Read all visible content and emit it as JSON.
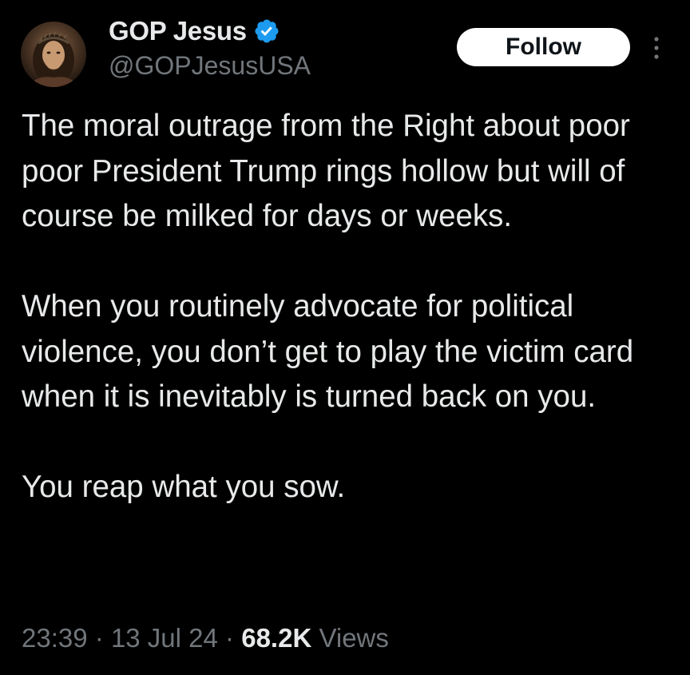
{
  "author": {
    "display_name": "GOP Jesus",
    "handle": "@GOPJesusUSA",
    "verified": true,
    "verified_color": "#1d9bf0",
    "avatar_icon": "profile-avatar"
  },
  "follow_label": "Follow",
  "more_icon": "more-options-icon",
  "tweet": {
    "paragraphs": [
      "The moral outrage from the Right about poor poor President Trump rings hollow but will of course be milked for days or weeks.",
      "When you routinely advocate for political violence, you don’t get to play the victim card when it is inevitably is turned back on you.",
      "You reap what you sow."
    ],
    "time": "23:39",
    "date": "13 Jul 24",
    "views_count": "68.2K",
    "views_label": "Views",
    "separator": "·"
  },
  "colors": {
    "background": "#000000",
    "text_primary": "#e7e9ea",
    "text_secondary": "#71767b",
    "button_bg": "#ffffff",
    "button_text": "#0f1419"
  }
}
